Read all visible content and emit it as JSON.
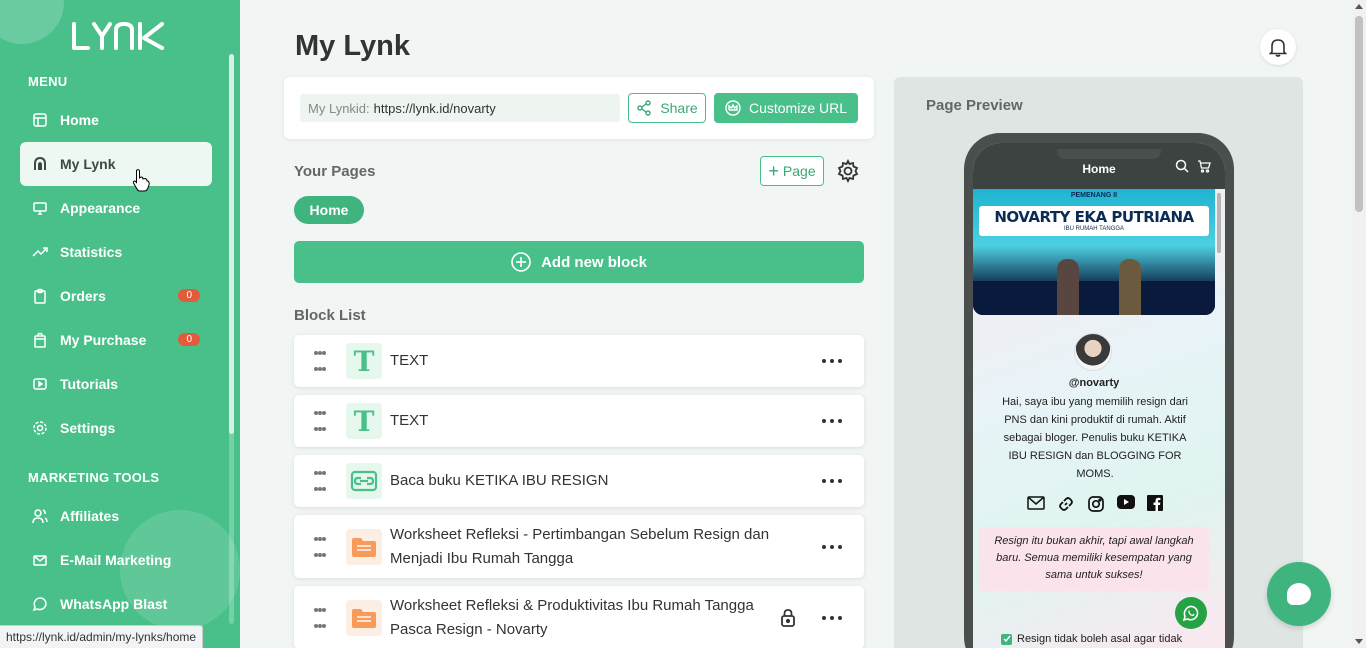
{
  "brand": {
    "logo_text": "LYNK"
  },
  "sidebar": {
    "menu_heading": "MENU",
    "items": [
      {
        "label": "Home",
        "icon": "home-icon"
      },
      {
        "label": "My Lynk",
        "icon": "lynk-icon",
        "active": true
      },
      {
        "label": "Appearance",
        "icon": "monitor-icon"
      },
      {
        "label": "Statistics",
        "icon": "trending-icon"
      },
      {
        "label": "Orders",
        "icon": "clipboard-icon",
        "badge": "0"
      },
      {
        "label": "My Purchase",
        "icon": "bag-icon",
        "badge": "0"
      },
      {
        "label": "Tutorials",
        "icon": "play-icon"
      },
      {
        "label": "Settings",
        "icon": "gear-icon"
      }
    ],
    "marketing_heading": "MARKETING TOOLS",
    "marketing_items": [
      {
        "label": "Affiliates",
        "icon": "users-icon"
      },
      {
        "label": "E-Mail Marketing",
        "icon": "mail-icon"
      },
      {
        "label": "WhatsApp Blast",
        "icon": "whatsapp-icon"
      }
    ]
  },
  "header": {
    "title": "My Lynk"
  },
  "url_card": {
    "label": "My Lynkid:",
    "value": "https://lynk.id/novarty",
    "share_label": "Share",
    "customize_label": "Customize URL"
  },
  "pages": {
    "heading": "Your Pages",
    "add_page_label": "Page",
    "tabs": [
      {
        "label": "Home"
      }
    ],
    "add_block_label": "Add new block"
  },
  "blocks": {
    "heading": "Block List",
    "items": [
      {
        "type": "text",
        "title": "TEXT"
      },
      {
        "type": "text",
        "title": "TEXT"
      },
      {
        "type": "link",
        "title": "Baca buku KETIKA IBU RESIGN"
      },
      {
        "type": "file",
        "title": "Worksheet Refleksi - Pertimbangan Sebelum Resign dan Menjadi Ibu Rumah Tangga"
      },
      {
        "type": "file",
        "title": "Worksheet Refleksi & Produktivitas Ibu Rumah Tangga Pasca Resign - Novarty",
        "locked": true
      }
    ]
  },
  "preview": {
    "label": "Page Preview",
    "phone_title": "Home",
    "banner_top": "PEMENANG II",
    "banner_name": "NOVARTY EKA PUTRIANA",
    "banner_role": "IBU RUMAH TANGGA",
    "handle": "@novarty",
    "bio": "Hai, saya ibu yang memilih resign dari PNS dan kini produktif di rumah. Aktif sebagai bloger. Penulis buku KETIKA IBU RESIGN dan BLOGGING FOR MOMS.",
    "quote": "Resign itu bukan akhir, tapi awal langkah baru. Semua memiliki kesempatan yang sama untuk sukses!",
    "check_text": "Resign tidak boleh asal agar tidak"
  },
  "status_bar": {
    "url": "https://lynk.id/admin/my-lynks/home"
  },
  "colors": {
    "brand": "#49c08a",
    "badge": "#e45a3d",
    "active_bg": "#eef8f3"
  }
}
